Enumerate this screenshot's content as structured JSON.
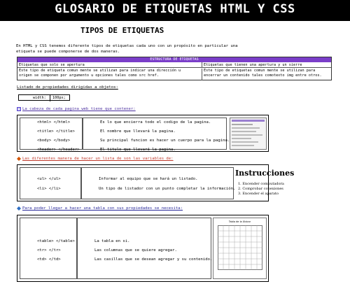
{
  "header": {
    "title": "GLOSARIO DE ETIQUETAS HTML Y CSS",
    "bg": "#000000"
  },
  "section_title": "TIPOS DE ETIQUETAS",
  "intro": {
    "line1": "En HTML y CSS tenemos diferente tipos de etiquetas cada uno con un propósito en particular una",
    "line2": "etiqueta se puede componerse de dos maneras."
  },
  "structure_table": {
    "header": "ESTRUCTURA DE ETIQUETAS",
    "accent": "#7a3ec9",
    "col1_title": "Etiquetas que solo se apertura",
    "col2_title": "Etiquetas que tienen una apertura y un sierre",
    "col1_desc_1": "Este tipo de etiqueta comun mente se utilizan para indicar una dirección u",
    "col1_desc_2": "origen se componen por argumento u opciones tales como src href.",
    "col2_desc_1": "Este tipo de etiquetas comun mente se utilizan para",
    "col2_desc_2": "encerrar un contenido tales comotexto img entre otros."
  },
  "properties_link": "Listado de propiedades dirigidas a objetos:",
  "width_example": {
    "label": "width:",
    "value": "100px;"
  },
  "head_link": "La cabeza de cada pagina web tiene que contener:",
  "head_rows": [
    {
      "tag": "<html> </html>",
      "desc": "Es lo que encierra todo el codigo de la pagina."
    },
    {
      "tag": "<title> </title>",
      "desc": "El nombre que llevará la pagina."
    },
    {
      "tag": "<body> </body>",
      "desc": "Su principal funcion es hacer un cuerpo para la pagina."
    },
    {
      "tag": "<header> </header>",
      "desc": "El titulo que llevará la pagina."
    }
  ],
  "list_link": "Las diferentes manera de hacer un lista de son las variables de:",
  "list_rows": [
    {
      "tag": "<ul> </ul>",
      "desc": "Informar al equipo que se hará un listado."
    },
    {
      "tag": "<li> </li>",
      "desc": "Un tipo de listador con un punto completar la información."
    }
  ],
  "instructions": {
    "title": "Instrucciones",
    "items": [
      "1.  Encender computadora",
      "2.  Comprobar conexiones",
      "3.  Encender el aparato"
    ]
  },
  "table_link": "Para poder llegar a hacer una tabla con sus propiedades se necesita:",
  "table_rows": [
    {
      "tag": "<table> </table>",
      "desc": "La tabla en si."
    },
    {
      "tag": "<tr> </tr>",
      "desc": "Las columnas que se quiere agregar."
    },
    {
      "tag": "<td> </td>",
      "desc": "Las casillas que se desean agregar y su contenido."
    }
  ],
  "table_thumb_caption": "Tabla de la Ubicar",
  "icons": [
    "gear-icon",
    "diamond-icon",
    "diamond-icon"
  ],
  "colors": {
    "purple": "#4b2fa0",
    "red": "#c0392b",
    "blue": "#2a2a9a"
  }
}
